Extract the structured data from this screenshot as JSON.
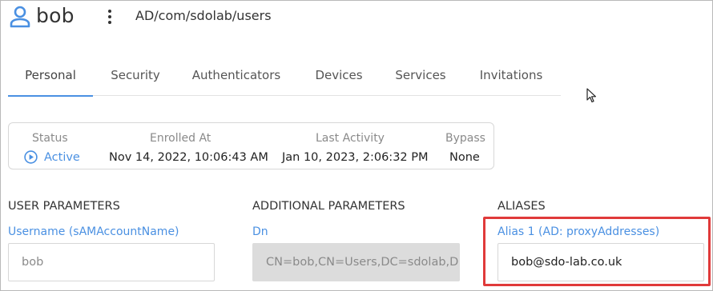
{
  "header": {
    "user_name": "bob",
    "path": "AD/com/sdolab/users"
  },
  "tabs": [
    {
      "label": "Personal",
      "active": true
    },
    {
      "label": "Security",
      "active": false
    },
    {
      "label": "Authenticators",
      "active": false
    },
    {
      "label": "Devices",
      "active": false
    },
    {
      "label": "Services",
      "active": false
    },
    {
      "label": "Invitations",
      "active": false
    }
  ],
  "status_card": {
    "status_label": "Status",
    "status_value": "Active",
    "enrolled_label": "Enrolled At",
    "enrolled_value": "Nov 14, 2022, 10:06:43 AM",
    "last_activity_label": "Last Activity",
    "last_activity_value": "Jan 10, 2023, 2:06:32 PM",
    "bypass_label": "Bypass",
    "bypass_value": "None"
  },
  "sections": {
    "user_parameters": {
      "title": "USER PARAMETERS",
      "field_label": "Username (sAMAccountName)",
      "field_value": "bob"
    },
    "additional_parameters": {
      "title": "ADDITIONAL PARAMETERS",
      "field_label": "Dn",
      "field_value": "CN=bob,CN=Users,DC=sdolab,DC="
    },
    "aliases": {
      "title": "ALIASES",
      "field_label": "Alias 1 (AD: proxyAddresses)",
      "field_value": "bob@sdo-lab.co.uk"
    }
  },
  "colors": {
    "accent": "#4a90e2",
    "highlight": "#e03a3a",
    "text": "#333333",
    "muted": "#8a8a8a"
  },
  "icons": {
    "user": "user-icon",
    "menu": "kebab-menu-icon",
    "status": "play-circle-icon",
    "cursor": "mouse-pointer-icon"
  }
}
